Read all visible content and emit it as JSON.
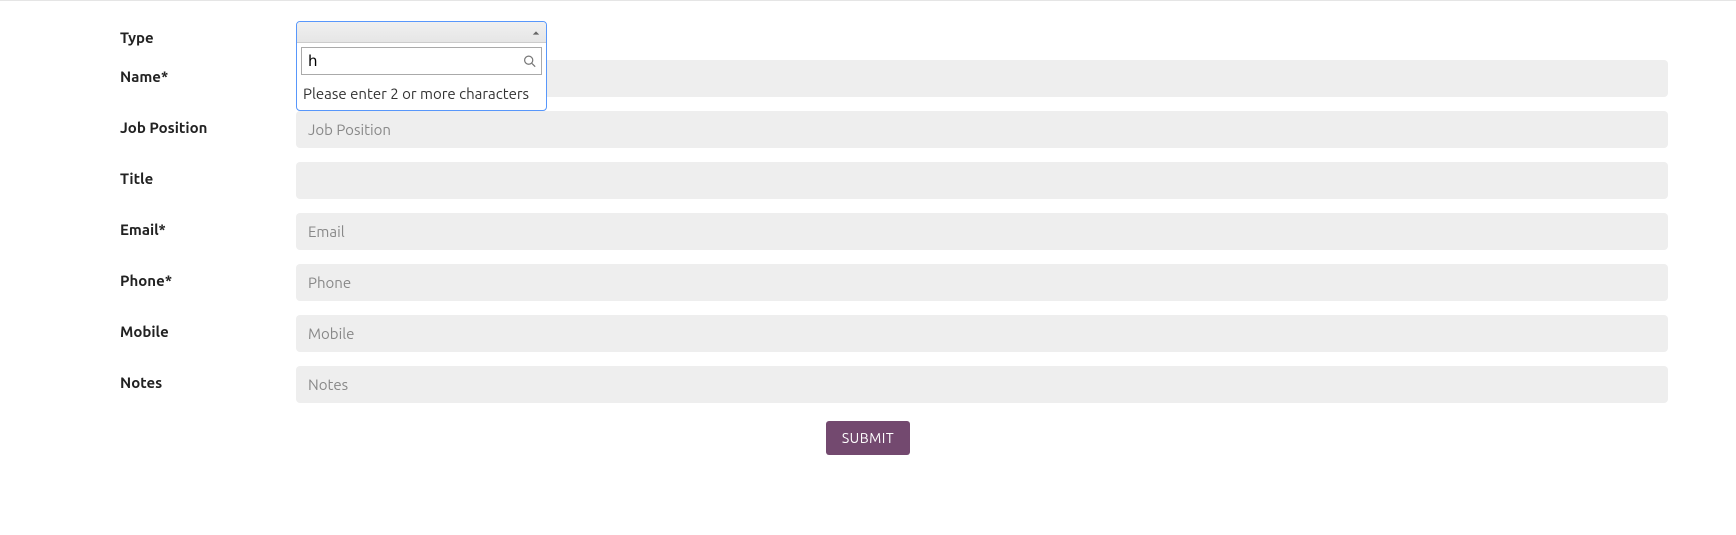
{
  "form": {
    "type": {
      "label": "Type",
      "search_value": "h",
      "message": "Please enter 2 or more characters"
    },
    "name": {
      "label": "Name*",
      "placeholder": "",
      "value": ""
    },
    "job_position": {
      "label": "Job Position",
      "placeholder": "Job Position",
      "value": ""
    },
    "title": {
      "label": "Title",
      "placeholder": "",
      "value": ""
    },
    "email": {
      "label": "Email*",
      "placeholder": "Email",
      "value": ""
    },
    "phone": {
      "label": "Phone*",
      "placeholder": "Phone",
      "value": ""
    },
    "mobile": {
      "label": "Mobile",
      "placeholder": "Mobile",
      "value": ""
    },
    "notes": {
      "label": "Notes",
      "placeholder": "Notes",
      "value": ""
    },
    "submit_label": "SUBMIT"
  }
}
